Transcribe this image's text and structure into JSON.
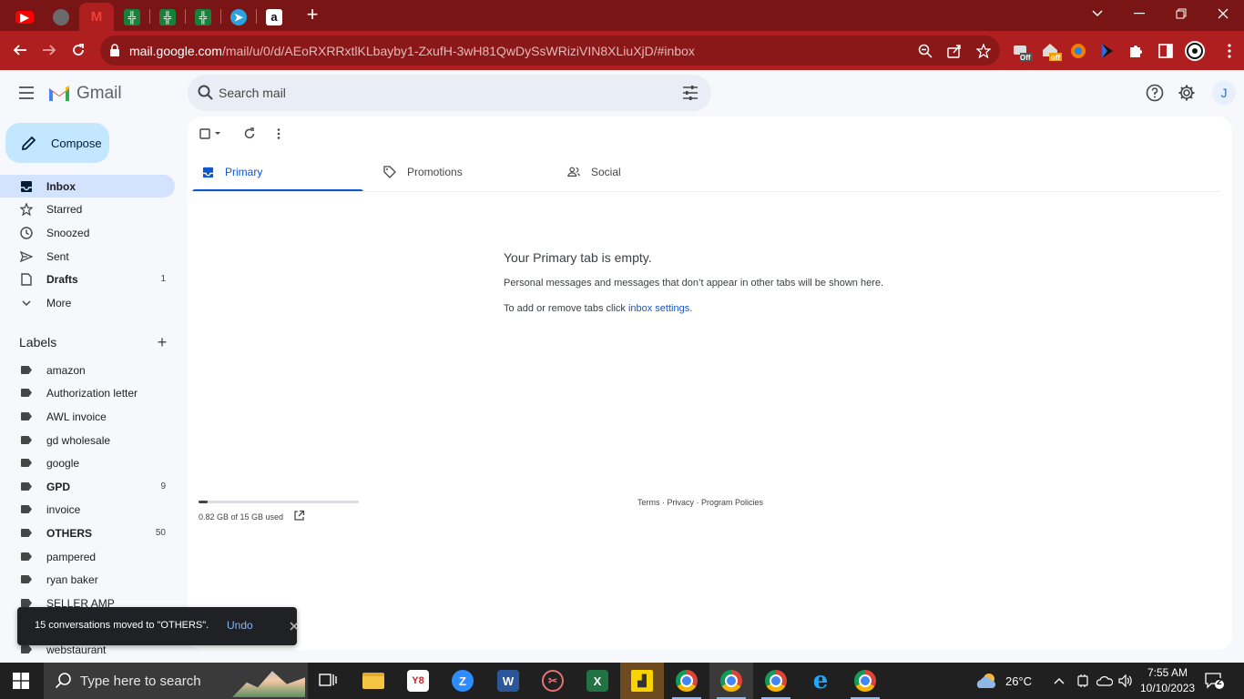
{
  "browser": {
    "url_host": "mail.google.com",
    "url_path": "/mail/u/0/d/AEoRXRRxtlKLbayby1-ZxufH-3wH81QwDySsWRiziVIN8XLiuXjD/#inbox",
    "ext_badges": [
      "Off",
      "off"
    ],
    "accent_color": "#b01f1f"
  },
  "gmail": {
    "logo_text": "Gmail",
    "search_placeholder": "Search mail",
    "avatar_initial": "J",
    "compose_label": "Compose"
  },
  "sidebar": {
    "nav": [
      {
        "label": "Inbox",
        "count": "",
        "icon": "inbox-icon",
        "active": true,
        "bold": true
      },
      {
        "label": "Starred",
        "count": "",
        "icon": "star-icon"
      },
      {
        "label": "Snoozed",
        "count": "",
        "icon": "clock-icon"
      },
      {
        "label": "Sent",
        "count": "",
        "icon": "send-icon"
      },
      {
        "label": "Drafts",
        "count": "1",
        "icon": "draft-icon",
        "bold": true
      },
      {
        "label": "More",
        "count": "",
        "icon": "chevron-down-icon"
      }
    ],
    "labels_title": "Labels",
    "labels": [
      {
        "label": "amazon",
        "count": ""
      },
      {
        "label": "Authorization letter",
        "count": ""
      },
      {
        "label": "AWL invoice",
        "count": ""
      },
      {
        "label": "gd wholesale",
        "count": ""
      },
      {
        "label": "google",
        "count": ""
      },
      {
        "label": "GPD",
        "count": "9",
        "bold": true
      },
      {
        "label": "invoice",
        "count": ""
      },
      {
        "label": "OTHERS",
        "count": "50",
        "bold": true
      },
      {
        "label": "pampered",
        "count": ""
      },
      {
        "label": "ryan baker",
        "count": ""
      },
      {
        "label": "SELLER AMP",
        "count": ""
      },
      {
        "label": "webstaurant",
        "count": ""
      }
    ]
  },
  "main": {
    "tabs": [
      {
        "label": "Primary",
        "icon": "inbox-icon",
        "active": true
      },
      {
        "label": "Promotions",
        "icon": "tag-icon"
      },
      {
        "label": "Social",
        "icon": "people-icon"
      }
    ],
    "empty_title": "Your Primary tab is empty.",
    "empty_line1": "Personal messages and messages that don’t appear in other tabs will be shown here.",
    "empty_line2_prefix": "To add or remove tabs click ",
    "empty_line2_link": "inbox settings",
    "empty_line2_suffix": ".",
    "storage_text": "0.82 GB of 15 GB used",
    "storage_fraction": 0.055,
    "footer": "Terms · Privacy · Program Policies"
  },
  "snackbar": {
    "message": "15 conversations moved to \"OTHERS\".",
    "undo_label": "Undo"
  },
  "taskbar": {
    "search_placeholder": "Type here to search",
    "weather": "26°C",
    "time": "7:55 AM",
    "date": "10/10/2023",
    "notifications": "2"
  }
}
